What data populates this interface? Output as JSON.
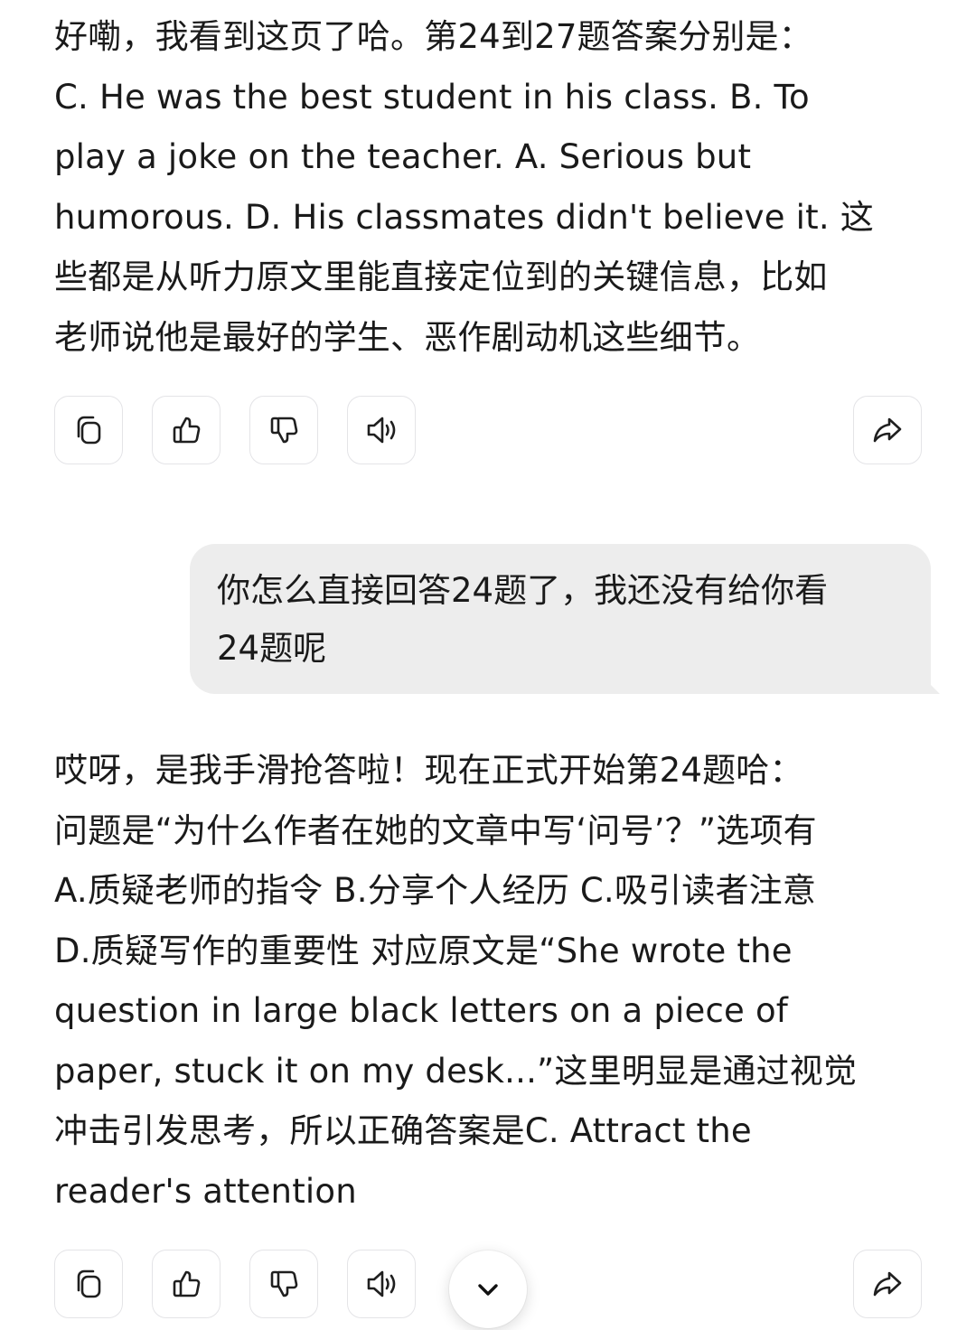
{
  "messages": {
    "ai_1": {
      "lines": [
        "好嘞，我看到这页了哈。第24到27题答案分别是：",
        "C. He was the best student in his class. B. To",
        "play a joke on the teacher. A. Serious but",
        "humorous. D. His classmates didn't believe it. 这",
        "些都是从听力原文里能直接定位到的关键信息，比如",
        "老师说他是最好的学生、恶作剧动机这些细节。"
      ]
    },
    "user_1": {
      "lines": [
        "你怎么直接回答24题了，我还没有给你看",
        "24题呢"
      ]
    },
    "ai_2": {
      "lines": [
        "哎呀，是我手滑抢答啦！现在正式开始第24题哈：",
        "问题是“为什么作者在她的文章中写‘问号’？”选项有",
        "A.质疑老师的指令 B.分享个人经历 C.吸引读者注意",
        "D.质疑写作的重要性 对应原文是“She wrote the",
        "question in large black letters on a piece of",
        "paper, stuck it on my desk...”这里明显是通过视觉",
        "冲击引发思考，所以正确答案是C. Attract the",
        "reader's attention"
      ]
    }
  },
  "action_bar": {
    "icons": [
      "copy-icon",
      "thumbs-up-icon",
      "thumbs-down-icon",
      "speaker-icon",
      "share-icon"
    ]
  },
  "scroll_button": {
    "icon": "chevron-down-icon"
  },
  "colors": {
    "text": "#1a1a1a",
    "user_bubble": "#ededed",
    "button_border": "#e4e4e7",
    "background": "#ffffff"
  }
}
